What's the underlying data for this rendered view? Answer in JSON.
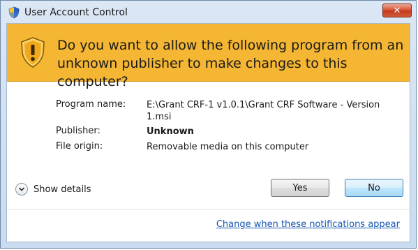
{
  "window": {
    "title": "User Account Control",
    "close_label": "✕"
  },
  "banner": {
    "question": "Do you want to allow the following program from an unknown publisher to make changes to this computer?"
  },
  "details": {
    "program_name_label": "Program name:",
    "program_name_value": "E:\\Grant CRF-1 v1.0.1\\Grant CRF Software - Version 1.msi",
    "publisher_label": "Publisher:",
    "publisher_value": "Unknown",
    "file_origin_label": "File origin:",
    "file_origin_value": "Removable media on this computer"
  },
  "actions": {
    "show_details_label": "Show details",
    "yes_label": "Yes",
    "no_label": "No"
  },
  "footer": {
    "link_label": "Change when these notifications appear"
  },
  "colors": {
    "banner": "#f4b633",
    "link": "#1556b3",
    "close_button": "#c43a1f"
  },
  "icons": {
    "title": "uac-shield-icon",
    "banner": "warning-shield-icon",
    "show_details": "chevron-down-icon"
  }
}
